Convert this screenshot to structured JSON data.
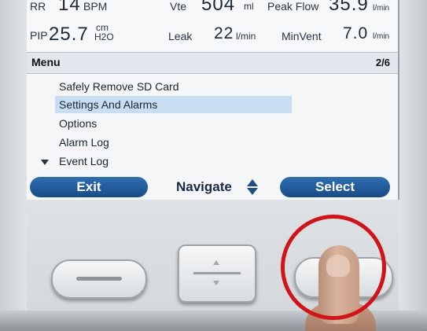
{
  "vitals": {
    "rr": {
      "label": "RR",
      "value": "14",
      "unit": "BPM"
    },
    "vte": {
      "label": "Vte",
      "value": "504",
      "unit": "ml"
    },
    "peak_flow": {
      "label": "Peak Flow",
      "value": "35.9",
      "unit": "l/min"
    },
    "pip": {
      "label": "PIP",
      "value": "25.7",
      "unit_top": "cm",
      "unit_bottom": "H2O"
    },
    "leak": {
      "label": "Leak",
      "value": "22",
      "unit": "l/min"
    },
    "min_vent": {
      "label": "MinVent",
      "value": "7.0",
      "unit": "l/min"
    }
  },
  "menu": {
    "title": "Menu",
    "page": "2/6",
    "items": [
      {
        "label": "Safely Remove SD Card",
        "selected": false
      },
      {
        "label": "Settings And Alarms",
        "selected": true
      },
      {
        "label": "Options",
        "selected": false
      },
      {
        "label": "Alarm Log",
        "selected": false
      },
      {
        "label": "Event Log",
        "selected": false
      }
    ]
  },
  "softkeys": {
    "exit": "Exit",
    "navigate": "Navigate",
    "select": "Select"
  },
  "colors": {
    "softkey_blue": "#174b86",
    "selection_highlight": "#c9ddf2",
    "annotation_ring": "#d0141a"
  },
  "icons": [
    "scroll-down-arrow-icon",
    "navigate-up-down-icon",
    "slot-icon",
    "up-down-rocker-icon"
  ]
}
